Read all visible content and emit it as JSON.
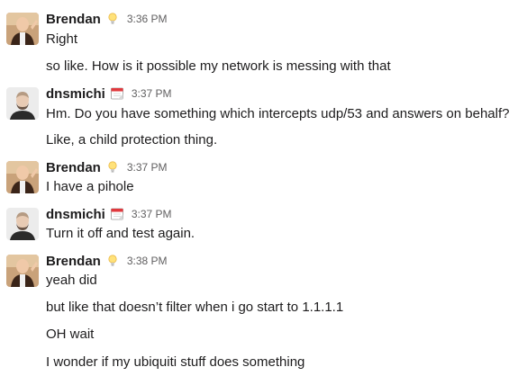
{
  "messages": [
    {
      "sender": "Brendan",
      "status_icon": "lightbulb-icon",
      "time": "3:36 PM",
      "lines": [
        "Right",
        "so like.  How is it possible my network is messing with that"
      ]
    },
    {
      "sender": "dnsmichi",
      "status_icon": "calendar-icon",
      "time": "3:37 PM",
      "lines": [
        "Hm. Do you have something which intercepts udp/53 and answers on behalf?",
        "Like, a child protection thing."
      ]
    },
    {
      "sender": "Brendan",
      "status_icon": "lightbulb-icon",
      "time": "3:37 PM",
      "lines": [
        "I have a pihole"
      ]
    },
    {
      "sender": "dnsmichi",
      "status_icon": "calendar-icon",
      "time": "3:37 PM",
      "lines": [
        "Turn it off and test again."
      ]
    },
    {
      "sender": "Brendan",
      "status_icon": "lightbulb-icon",
      "time": "3:38 PM",
      "lines": [
        "yeah did",
        "but like that doesn’t filter when i go start to 1.1.1.1",
        "OH wait",
        "I wonder if my ubiquiti stuff does something"
      ]
    }
  ]
}
